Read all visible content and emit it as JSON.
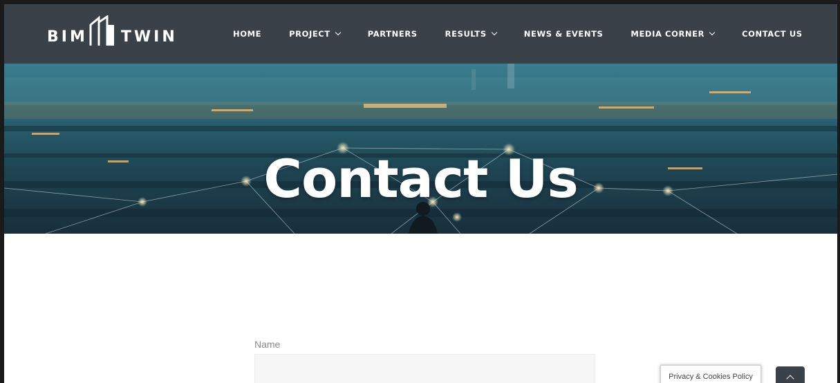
{
  "brand": {
    "logo_left": "BIM",
    "logo_right": "TWIN",
    "logo_icon": "building-icon"
  },
  "nav": {
    "items": [
      {
        "label": "HOME",
        "dropdown": false
      },
      {
        "label": "PROJECT",
        "dropdown": true
      },
      {
        "label": "PARTNERS",
        "dropdown": false
      },
      {
        "label": "RESULTS",
        "dropdown": true
      },
      {
        "label": "NEWS & EVENTS",
        "dropdown": false
      },
      {
        "label": "MEDIA CORNER",
        "dropdown": true
      },
      {
        "label": "CONTACT US",
        "dropdown": false,
        "active": true
      }
    ]
  },
  "hero": {
    "title": "Contact Us"
  },
  "form": {
    "name_label": "Name",
    "name_value": ""
  },
  "cookie": {
    "label": "Privacy & Cookies Policy"
  },
  "scroll_top": {
    "icon": "chevron-up-icon"
  },
  "colors": {
    "header_bg": "#3a4149",
    "hero_tint": "#1f4f63",
    "text_light": "#ffffff",
    "label_gray": "#8a8a8a"
  }
}
